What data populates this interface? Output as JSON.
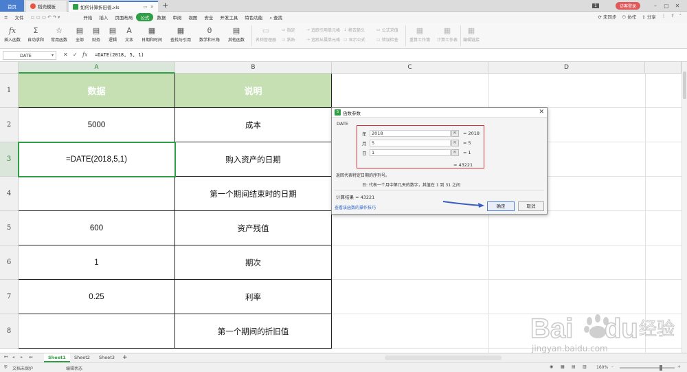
{
  "window": {
    "tabs": [
      {
        "label": "首页"
      },
      {
        "label": "稻壳模板"
      },
      {
        "label": "如何计算折旧值.xls"
      }
    ],
    "visitor_label": "访客登录",
    "badge": "1"
  },
  "menu": {
    "file_label": "文件",
    "items": [
      "开始",
      "插入",
      "页面布局",
      "公式",
      "数据",
      "审阅",
      "视图",
      "安全",
      "开发工具",
      "特色功能"
    ],
    "active": "公式",
    "search_label": "查找",
    "right_items": [
      "未同步",
      "协作",
      "分享"
    ]
  },
  "ribbon": {
    "buttons": [
      "插入函数",
      "自动求和",
      "常用函数",
      "全部",
      "财务",
      "逻辑",
      "文本",
      "日期和时间",
      "查找与引用",
      "数学和三角",
      "其他函数"
    ],
    "dim_buttons": [
      "名称管理器",
      "粘贴",
      "重算工作簿",
      "计算工作表",
      "编辑链接"
    ],
    "small": [
      "指定",
      "追踪引用单元格",
      "追踪从属单元格",
      "移去箭头",
      "显示公式",
      "公式求值",
      "错误检查"
    ]
  },
  "formula_bar": {
    "name_box": "DATE",
    "fx": "fx",
    "formula": "=DATE(2018, 5, 1)"
  },
  "grid": {
    "columns": [
      "A",
      "B",
      "C",
      "D"
    ],
    "rows": [
      "1",
      "2",
      "3",
      "4",
      "5",
      "6",
      "7",
      "8"
    ],
    "header": {
      "a": "数据",
      "b": "说明"
    },
    "cells": [
      {
        "a": "5000",
        "b": "成本"
      },
      {
        "a": "=DATE(2018,5,1)",
        "b": "购入资产的日期"
      },
      {
        "a": "",
        "b": "第一个期间结束时的日期"
      },
      {
        "a": "600",
        "b": "资产残值"
      },
      {
        "a": "1",
        "b": "期次"
      },
      {
        "a": "0.25",
        "b": "利率"
      },
      {
        "a": "",
        "b": "第一个期间的折旧值"
      }
    ]
  },
  "dialog": {
    "title": "函数参数",
    "function_name": "DATE",
    "args": [
      {
        "name": "年",
        "value": "2018",
        "result": "= 2018"
      },
      {
        "name": "月",
        "value": "5",
        "result": "= 5"
      },
      {
        "name": "日",
        "value": "1",
        "result": "= 1"
      }
    ],
    "total": "= 43221",
    "description": "返回代表特定日期的序列号。",
    "arg_description": "日: 代表一个月中第几天的数字，其值在 1 到 31 之间",
    "result": "计算结果 = 43221",
    "help_link": "查看该函数的操作技巧",
    "ok_label": "确定",
    "cancel_label": "取消",
    "highlight_color": "#d8323c"
  },
  "sheets": {
    "tabs": [
      "Sheet1",
      "Sheet2",
      "Sheet3"
    ],
    "active": "Sheet1",
    "add": "+"
  },
  "status": {
    "protect": "文档未保护",
    "mode": "编辑状态",
    "zoom": "160%"
  },
  "watermark": {
    "brand": "Bai",
    "brand2": "du",
    "brand_cn": "经验",
    "url": "jingyan.baidu.com"
  },
  "colors": {
    "accent": "#2f9e44",
    "header_fill": "#c6e0b4",
    "home_tab": "#4a7fcf"
  }
}
